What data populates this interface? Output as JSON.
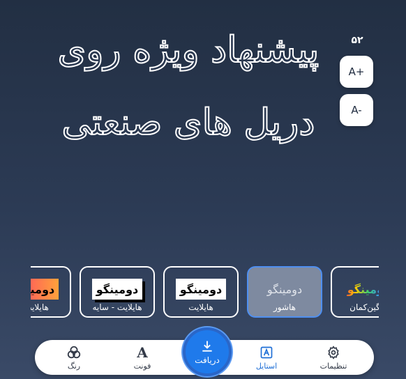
{
  "canvas": {
    "line1": "پیشنهاد ویژه روی",
    "line2": "دریل های صنعتی"
  },
  "size_control": {
    "value": "۵۲",
    "increase_label": "A+",
    "decrease_label": "A-"
  },
  "styles": [
    {
      "preview": "دومینگو",
      "label": "رنگین‌کمان"
    },
    {
      "preview": "دومینگو",
      "label": "هاشور"
    },
    {
      "preview": "دومینگو",
      "label": "هایلایت"
    },
    {
      "preview": "دومینگو",
      "label": "هایلایت - سایه"
    },
    {
      "preview": "دومینگو",
      "label": "هایلایت -"
    }
  ],
  "nav": {
    "settings": "تنظیمات",
    "style": "استایل",
    "download": "دریافت",
    "font": "فونت",
    "color": "رنگ"
  },
  "colors": {
    "accent": "#1f7aeb",
    "selected_card": "#7e8aa0",
    "background": "#2c3b55"
  }
}
